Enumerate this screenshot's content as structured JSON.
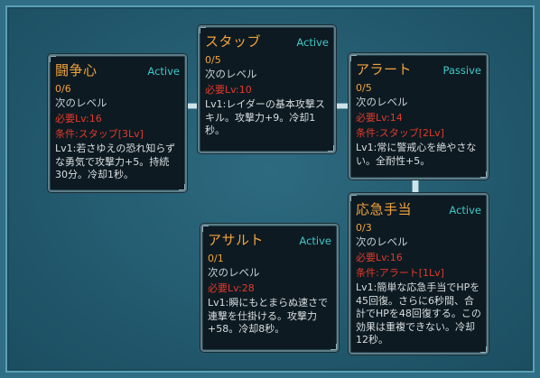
{
  "skills": {
    "toso": {
      "title": "闘争心",
      "type": "Active",
      "level": "0/6",
      "next_label": "次のレベル",
      "required": "必要Lv:16",
      "condition": "条件:スタッブ[3Lv]",
      "description": "Lv1:若さゆえの恐れ知らずな勇気で攻撃力+5。持続30分。冷却1秒。"
    },
    "stab": {
      "title": "スタッブ",
      "type": "Active",
      "level": "0/5",
      "next_label": "次のレベル",
      "required": "必要Lv:10",
      "description": "Lv1:レイダーの基本攻撃スキル。攻撃力+9。冷却1秒。"
    },
    "alert": {
      "title": "アラート",
      "type": "Passive",
      "level": "0/5",
      "next_label": "次のレベル",
      "required": "必要Lv:14",
      "condition": "条件:スタッブ[2Lv]",
      "description": "Lv1:常に警戒心を絶やさない。全耐性+5。"
    },
    "assault": {
      "title": "アサルト",
      "type": "Active",
      "level": "0/1",
      "next_label": "次のレベル",
      "required": "必要Lv:28",
      "description": "Lv1:瞬にもとまらぬ速さで連撃を仕掛ける。攻撃力+58。冷却8秒。"
    },
    "first_aid": {
      "title": "応急手当",
      "type": "Active",
      "level": "0/3",
      "next_label": "次のレベル",
      "required": "必要Lv:16",
      "condition": "条件:アラート[1Lv]",
      "description": "Lv1:簡単な応急手当でHPを45回復。さらに6秒間、合計でHPを48回復する。この効果は重複できない。冷却12秒。"
    }
  }
}
